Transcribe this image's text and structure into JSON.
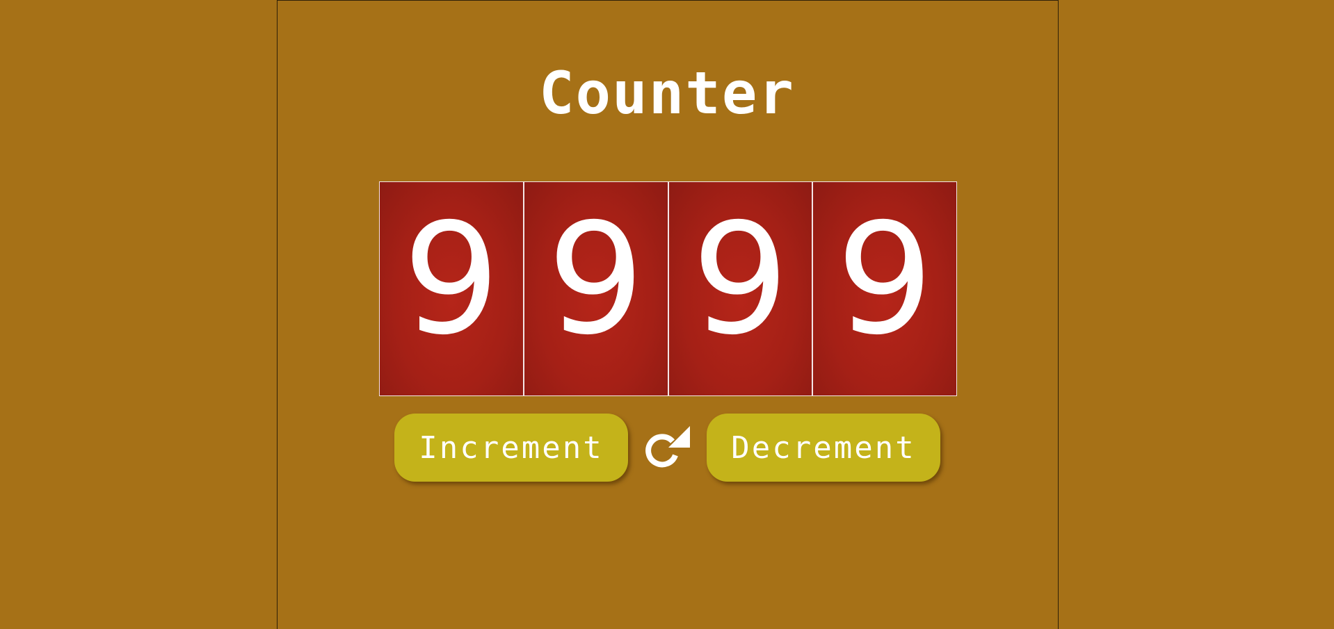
{
  "page": {
    "title": "Counter",
    "background_color": "#a67117"
  },
  "counter": {
    "digits": [
      "9",
      "9",
      "9",
      "9"
    ],
    "tile_color": "#a52016",
    "digit_color": "#ffffff"
  },
  "controls": {
    "increment_label": "Increment",
    "decrement_label": "Decrement",
    "reset_icon": "refresh-icon",
    "button_color": "#c4b31a"
  }
}
